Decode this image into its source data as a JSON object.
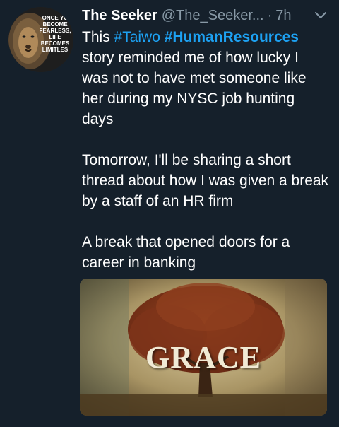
{
  "tweet": {
    "author_name": "The Seeker",
    "author_handle": "@The_Seeker...",
    "separator": "·",
    "timestamp": "7h",
    "avatar_text": [
      "ONCE YO",
      "BECOME",
      "FEARLESS,",
      "LIFE",
      "BECOMES",
      "LIMITLES"
    ],
    "body_intro": "This",
    "hashtag_1": "#Taiwo",
    "hashtag_2": "#HumanResources",
    "body_line_1": " story reminded me of how lucky I was not to have met someone like her during my NYSC job hunting days",
    "body_paragraph_2": "Tomorrow, I'll be sharing a short thread about how I was given a break by a staff of an HR firm",
    "body_paragraph_3": "A break that opened doors for a career in banking",
    "media_caption": "GRACE",
    "icons": {
      "menu": "chevron-down-icon"
    },
    "colors": {
      "background": "#15202b",
      "hashtag": "#1da1f2",
      "muted": "#8899a6"
    }
  }
}
